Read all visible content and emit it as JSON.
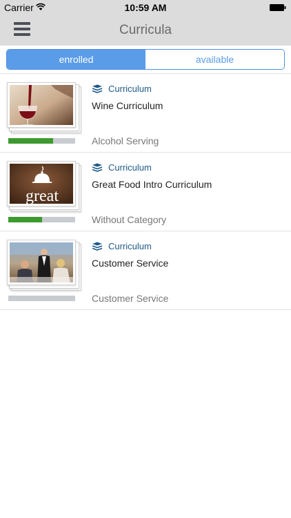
{
  "status_bar": {
    "carrier": "Carrier",
    "time": "10:59 AM",
    "wifi_icon": "wifi-icon",
    "battery_icon": "battery-icon"
  },
  "nav": {
    "title": "Curricula",
    "menu_icon": "hamburger-menu-icon"
  },
  "segments": {
    "enrolled": "enrolled",
    "available": "available",
    "selected": "enrolled"
  },
  "colors": {
    "accent": "#5b9ce8",
    "progress_fill": "#3d9a2f",
    "progress_track": "#c8ccd0",
    "type_label": "#1e5a8a",
    "header_bg": "#dcdcdc"
  },
  "items": [
    {
      "type_label": "Curriculum",
      "type_icon": "book-stack-icon",
      "title": "Wine Curriculum",
      "category": "Alcohol Serving",
      "progress": 0.67,
      "thumbnail": "wine-pour-image"
    },
    {
      "type_label": "Curriculum",
      "type_icon": "book-stack-icon",
      "title": "Great Food Intro Curriculum",
      "category": "Without Category",
      "progress": 0.5,
      "thumbnail": "great-logo-image",
      "thumbnail_text": "great"
    },
    {
      "type_label": "Curriculum",
      "type_icon": "book-stack-icon",
      "title": "Customer Service",
      "category": "Customer Service",
      "progress": 0,
      "thumbnail": "waiter-restaurant-image"
    }
  ]
}
